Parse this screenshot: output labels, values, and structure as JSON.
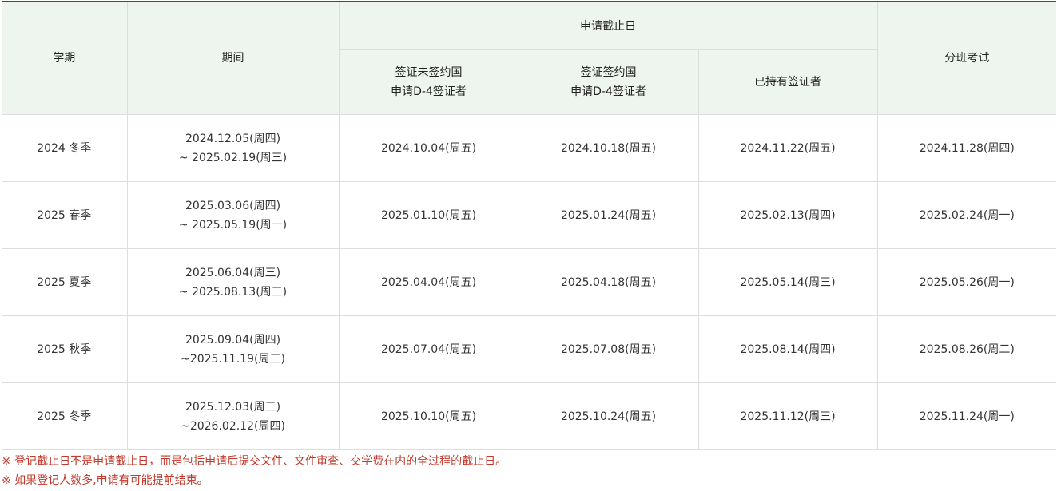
{
  "table": {
    "headers": {
      "term": "学期",
      "period": "期间",
      "deadline_group": "申请截止日",
      "deadline_cols": [
        {
          "line1": "签证未签约国",
          "line2": "申请D-4签证者"
        },
        {
          "line1": "签证签约国",
          "line2": "申请D-4签证者"
        },
        {
          "line1": "已持有签证者",
          "line2": ""
        }
      ],
      "placement_test": "分班考试"
    },
    "rows": [
      {
        "term": "2024 冬季",
        "period_start": "2024.12.05(周四)",
        "period_end": "~ 2025.02.19(周三)",
        "deadline_non_agreement": "2024.10.04(周五)",
        "deadline_agreement": "2024.10.18(周五)",
        "deadline_visa_holder": "2024.11.22(周五)",
        "placement_test": "2024.11.28(周四)"
      },
      {
        "term": "2025 春季",
        "period_start": "2025.03.06(周四)",
        "period_end": "~ 2025.05.19(周一)",
        "deadline_non_agreement": "2025.01.10(周五)",
        "deadline_agreement": "2025.01.24(周五)",
        "deadline_visa_holder": "2025.02.13(周四)",
        "placement_test": "2025.02.24(周一)"
      },
      {
        "term": "2025 夏季",
        "period_start": "2025.06.04(周三)",
        "period_end": "~ 2025.08.13(周三)",
        "deadline_non_agreement": "2025.04.04(周五)",
        "deadline_agreement": "2025.04.18(周五)",
        "deadline_visa_holder": "2025.05.14(周三)",
        "placement_test": "2025.05.26(周一)"
      },
      {
        "term": "2025 秋季",
        "period_start": "2025.09.04(周四)",
        "period_end": "~2025.11.19(周三)",
        "deadline_non_agreement": "2025.07.04(周五)",
        "deadline_agreement": "2025.07.08(周五)",
        "deadline_visa_holder": "2025.08.14(周四)",
        "placement_test": "2025.08.26(周二)"
      },
      {
        "term": "2025 冬季",
        "period_start": "2025.12.03(周三)",
        "period_end": "~2026.02.12(周四)",
        "deadline_non_agreement": "2025.10.10(周五)",
        "deadline_agreement": "2025.10.24(周五)",
        "deadline_visa_holder": "2025.11.12(周三)",
        "placement_test": "2025.11.24(周一)"
      }
    ]
  },
  "notes": [
    "※ 登记截止日不是申请截止日，而是包括申请后提交文件、文件审查、交学费在内的全过程的截止日。",
    "※ 如果登记人数多,申请有可能提前结束。"
  ],
  "colors": {
    "header_bg": "#eef4ee",
    "top_border": "#2d5a3d",
    "note_text": "#c0392b",
    "grid_line": "#dddddd"
  }
}
